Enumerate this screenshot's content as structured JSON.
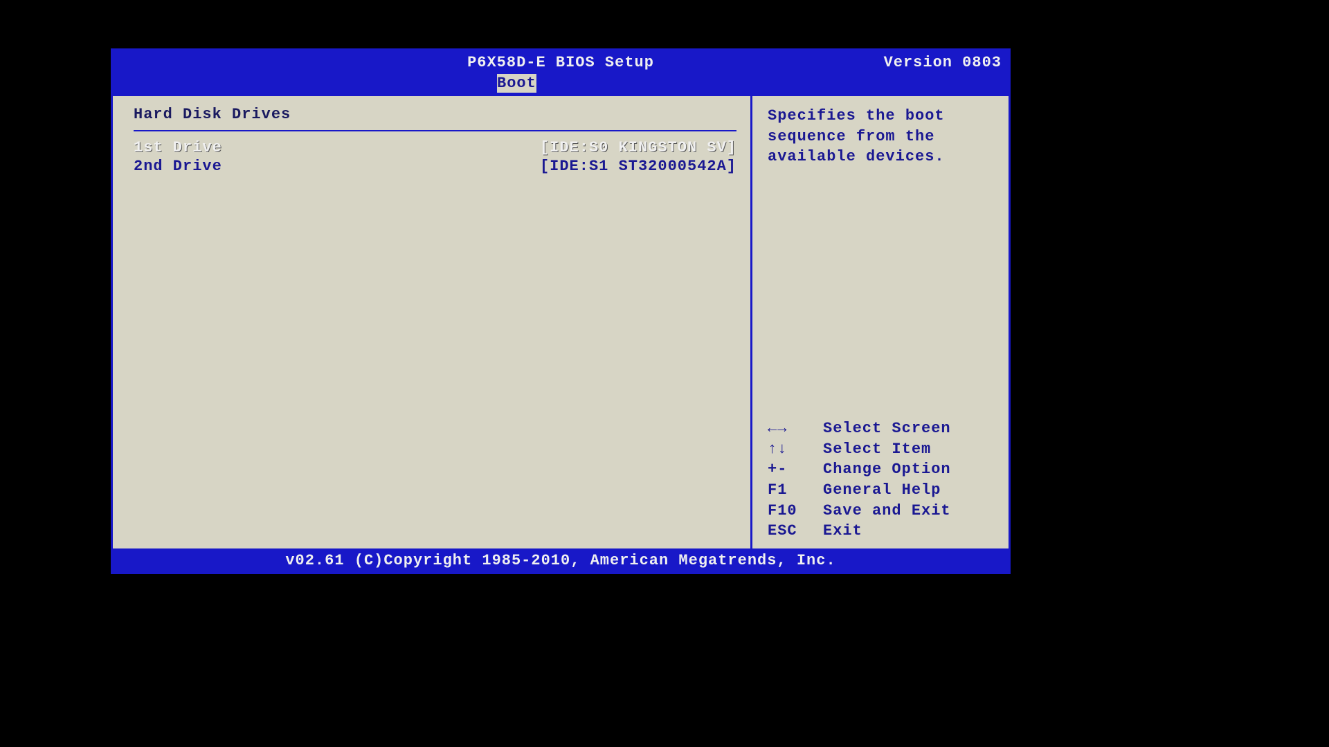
{
  "header": {
    "title": "P6X58D-E BIOS Setup",
    "version": "Version 0803",
    "active_tab": "Boot"
  },
  "panel": {
    "heading": "Hard Disk Drives",
    "rows": [
      {
        "label": "1st Drive",
        "value": "[IDE:S0 KINGSTON SV]",
        "selected": true
      },
      {
        "label": "2nd Drive",
        "value": "[IDE:S1 ST32000542A]",
        "selected": false
      }
    ]
  },
  "help": {
    "description": "Specifies the boot\nsequence from the\navailable devices.",
    "keys": [
      {
        "key": "←→",
        "desc": "Select Screen"
      },
      {
        "key": "↑↓",
        "desc": "Select Item"
      },
      {
        "key": "+-",
        "desc": "Change Option"
      },
      {
        "key": "F1",
        "desc": "General Help"
      },
      {
        "key": "F10",
        "desc": "Save and Exit"
      },
      {
        "key": "ESC",
        "desc": "Exit"
      }
    ]
  },
  "footer": {
    "copyright": "v02.61 (C)Copyright 1985-2010, American Megatrends, Inc."
  }
}
